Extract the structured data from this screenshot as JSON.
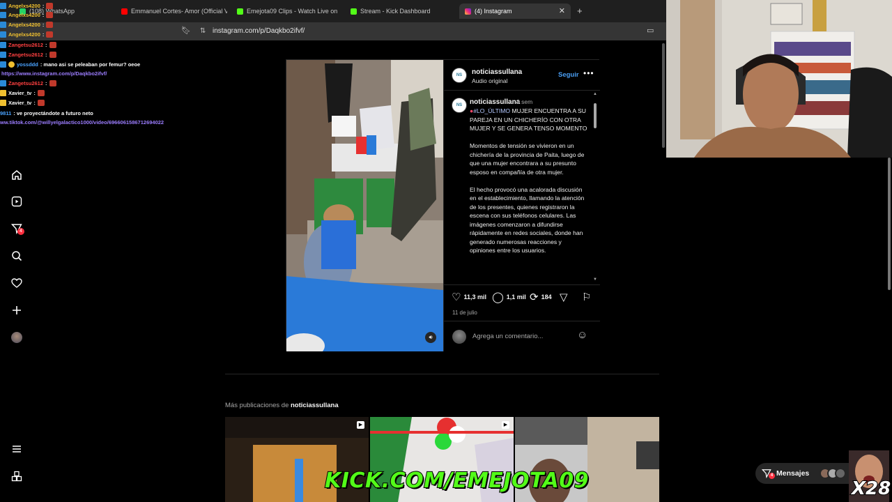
{
  "browser": {
    "tabs": [
      {
        "label": "(108) WhatsApp",
        "icon": "whatsapp-icon",
        "color": "#25d366"
      },
      {
        "label": "Emmanuel Cortes- Amor (Official Vid",
        "icon": "youtube-icon",
        "color": "#ff0000"
      },
      {
        "label": "Emejota09 Clips - Watch Live on",
        "icon": "kick-icon",
        "color": "#53fc18"
      },
      {
        "label": "Stream - Kick Dashboard",
        "icon": "kick-icon",
        "color": "#53fc18"
      },
      {
        "label": "(4) Instagram",
        "icon": "instagram-icon",
        "color": "#e1306c",
        "active": true
      }
    ],
    "close_glyph": "✕",
    "new_tab_glyph": "+",
    "url": "instagram.com/p/Daqkbo2ifvf/"
  },
  "nav": {
    "icons": [
      "home-icon",
      "reels-icon",
      "messages-icon",
      "search-icon",
      "notifications-icon",
      "create-icon",
      "profile-icon",
      "more-menu-icon",
      "threads-icon"
    ],
    "messages_badge": "4"
  },
  "post": {
    "username": "noticiassullana",
    "audio": "Audio original",
    "follow_label": "Seguir",
    "caption_time": "3 sem",
    "hashtag": "#LO_ÚLTIMO",
    "caption_headline": " MUJER ENCUENTRA A SU PAREJA EN UN CHICHERÍO CON OTRA MUJER Y SE GENERA TENSO MOMENTO",
    "caption_p2": "Momentos de tensión se vivieron en un chichería de la provincia de Paita, luego de que una mujer encontrara a su presunto esposo en compañía de otra mujer.",
    "caption_p3": "El hecho provocó una acalorada discusión en el establecimiento, llamando la atención de los presentes, quienes registraron la escena con sus teléfonos celulares. Las imágenes comenzaron a difundirse rápidamente en redes sociales, donde han generado numerosas reacciones y opiniones entre los usuarios.",
    "likes": "11,3 mil",
    "comments": "1,1 mil",
    "reposts": "184",
    "date": "11 de julio",
    "comment_placeholder": "Agrega un comentario..."
  },
  "more": {
    "prefix": "Más publicaciones de ",
    "username": "noticiassullana"
  },
  "messages_pill": {
    "label": "Mensajes",
    "badge": "4"
  },
  "chat": [
    {
      "user": "Angelxs4200",
      "color": "#f0c030",
      "text": ":",
      "emote": true
    },
    {
      "user": "Angelxs4200",
      "color": "#f0c030",
      "text": ":",
      "emote": true
    },
    {
      "user": "Angelxs4200",
      "color": "#f0c030",
      "text": ":",
      "emote": true
    },
    {
      "user": "Angelxs4200",
      "color": "#f0c030",
      "text": ":",
      "emote": true
    },
    {
      "user": "Zangetsu2612",
      "color": "#ff4040",
      "text": ":",
      "emote": true
    },
    {
      "user": "Zangetsu2612",
      "color": "#ff4040",
      "text": ":",
      "emote": true
    },
    {
      "user": "yossddd",
      "color": "#4aa3ff",
      "text": ": mano asi se peleaban por femur? oeoe",
      "emote": false
    },
    {
      "user": "",
      "color": "#9c7dff",
      "text": "https://www.instagram.com/p/Daqkbo2ifvf/",
      "emote": false,
      "link": true
    },
    {
      "user": "Zangetsu2612",
      "color": "#ff4040",
      "text": ":",
      "emote": true
    },
    {
      "user": "Xavier_tv",
      "color": "#ffffff",
      "text": ":",
      "emote": true
    },
    {
      "user": "Xavier_tv",
      "color": "#ffffff",
      "text": ":",
      "emote": true
    },
    {
      "user": "9811",
      "color": "#4aa3ff",
      "text": ": ve proyectándote a futuro neto",
      "emote": false
    },
    {
      "user": "",
      "color": "#9c7dff",
      "text": "ww.tiktok.com/@willyelgalactico1000/video/6966061586712694022",
      "emote": false,
      "link": true
    }
  ],
  "overlay": {
    "banner": "KICK.COM/EMEJOTA09",
    "multiplier": "X28"
  },
  "colors": {
    "kick_green": "#53fc18",
    "follow_blue": "#4a9ff5",
    "badge_red": "#ff3040"
  }
}
